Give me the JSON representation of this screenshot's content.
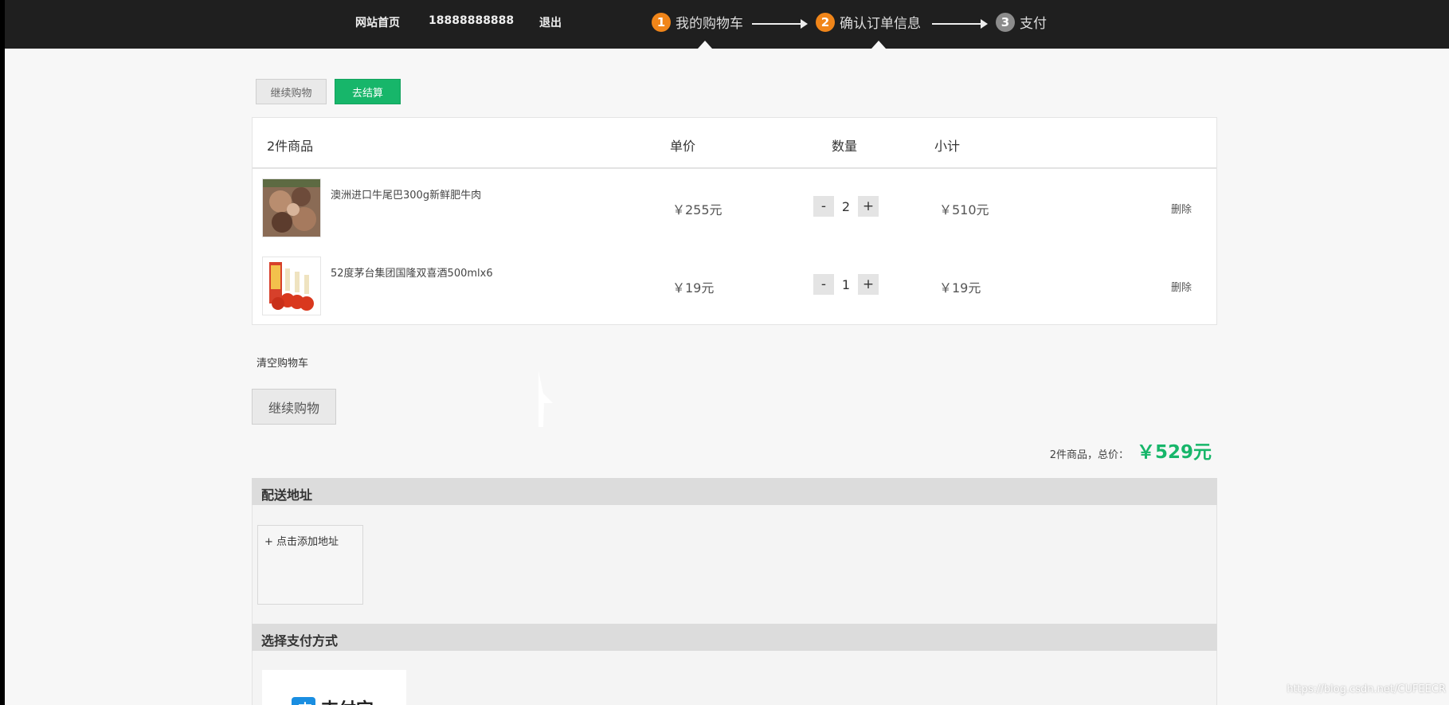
{
  "header": {
    "nav": {
      "home": "网站首页",
      "phone": "18888888888",
      "logout": "退出"
    },
    "steps": [
      {
        "num": "1",
        "label": "我的购物车",
        "color": "#f08519"
      },
      {
        "num": "2",
        "label": "确认订单信息",
        "color": "#f08519"
      },
      {
        "num": "3",
        "label": "支付",
        "color": "#8c8c8c"
      }
    ]
  },
  "actions": {
    "continue_label": "继续购物",
    "checkout_label": "去结算"
  },
  "cart": {
    "headers": {
      "items": "2件商品",
      "price": "单价",
      "quantity": "数量",
      "subtotal": "小计"
    },
    "rows": [
      {
        "name": "澳洲进口牛尾巴300g新鲜肥牛肉",
        "price": "￥255元",
        "qty": "2",
        "subtotal": "￥510元",
        "delete": "删除",
        "minus": "-",
        "plus": "+"
      },
      {
        "name": "52度茅台集团国隆双喜酒500mlx6",
        "price": "￥19元",
        "qty": "1",
        "subtotal": "￥19元",
        "delete": "删除",
        "minus": "-",
        "plus": "+"
      }
    ]
  },
  "clear_cart": "清空购物车",
  "continue_shopping": "继续购物",
  "summary": {
    "label": "2件商品，总价：",
    "total": "￥529元"
  },
  "address": {
    "title": "配送地址",
    "add": "+ 点击添加地址"
  },
  "payment": {
    "title": "选择支付方式",
    "alipay": "支付宝"
  },
  "watermark": "https://blog.csdn.net/CUFEECR",
  "colors": {
    "accent_green": "#17b66a",
    "step_orange": "#f08519",
    "topbar": "#1f1f1f"
  }
}
